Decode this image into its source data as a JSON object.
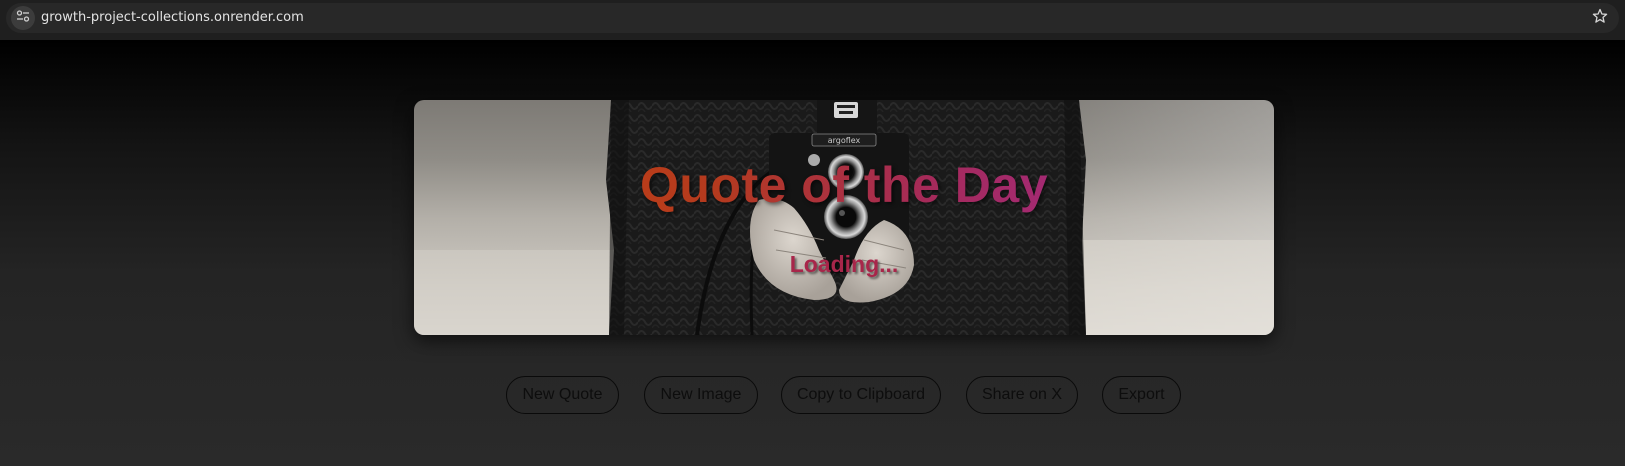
{
  "browser": {
    "url": "growth-project-collections.onrender.com",
    "site_info_icon": "tune-icon",
    "bookmark_icon": "star-outline-icon"
  },
  "hero": {
    "title": "Quote of the Day",
    "quote": "Loading...",
    "background": "black-and-white photo of a person in a knit sweater holding a twin-lens reflex camera",
    "camera_brand_plate": "argoflex",
    "title_gradient": [
      "#c8430f",
      "#a52a5a",
      "#a028a0"
    ],
    "quote_color": "#a8264a"
  },
  "actions": {
    "new_quote": "New Quote",
    "new_image": "New Image",
    "copy": "Copy to Clipboard",
    "share": "Share on X",
    "export": "Export"
  },
  "theme": {
    "browser_bar": "#1f1f1f",
    "page_bottom": "#2a2a2a",
    "button_border": "#0a0a0a"
  }
}
